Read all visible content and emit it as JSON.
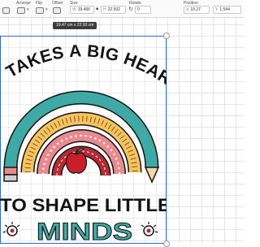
{
  "toolbar": {
    "size_label": "Size",
    "arrange_label": "Arrange",
    "flip_label": "Flip",
    "offset_label": "Offset",
    "rotate_label": "Rotate",
    "position_label": "Position",
    "width_prefix": "W",
    "width_value": "19.466",
    "height_prefix": "H",
    "height_value": "22.932",
    "rotate_value": "0",
    "x_prefix": "X",
    "x_value": "10.27",
    "y_prefix": "Y",
    "y_value": "1.544"
  },
  "canvas": {
    "dimension_tooltip": "19.47 cm x 22.93 cm"
  },
  "design": {
    "line1": "IT TAKES A BIG HEART",
    "line2": "TO SHAPE LITTLE",
    "line3": "MINDS",
    "colors": {
      "teal": "#3fa9a6",
      "yellow": "#f6c35f",
      "pink": "#e98a8f",
      "red": "#b42a35",
      "ink": "#141414",
      "selection": "#2a6dd6"
    }
  },
  "icons": {
    "arrange": "arrange-icon",
    "flip": "flip-icon",
    "offset": "offset-icon",
    "rotate": "rotate-icon",
    "lock": "lock-icon",
    "apple": "apple-icon",
    "lightbulb": "lightbulb-icon"
  }
}
